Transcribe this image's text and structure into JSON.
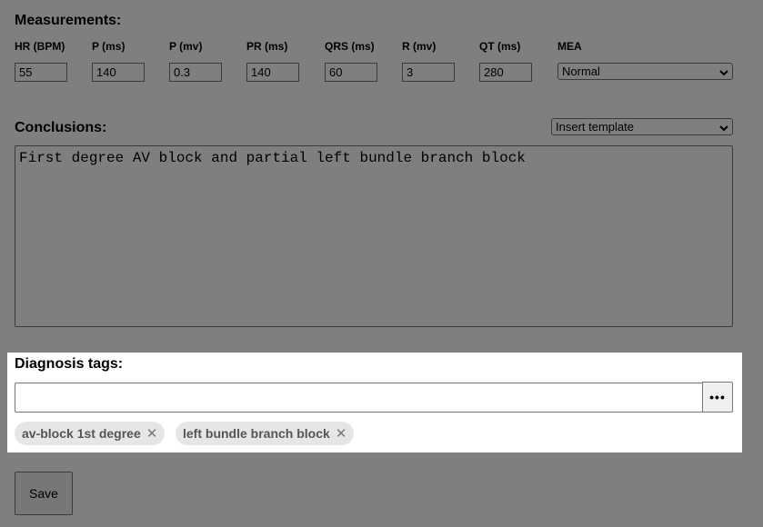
{
  "measurements": {
    "title": "Measurements:",
    "fields": [
      {
        "label": "HR (BPM)",
        "value": "55"
      },
      {
        "label": "P (ms)",
        "value": "140"
      },
      {
        "label": "P (mv)",
        "value": "0.3"
      },
      {
        "label": "PR (ms)",
        "value": "140"
      },
      {
        "label": "QRS (ms)",
        "value": "60"
      },
      {
        "label": "R (mv)",
        "value": "3"
      },
      {
        "label": "QT (ms)",
        "value": "280"
      }
    ],
    "mea": {
      "label": "MEA",
      "value": "Normal"
    }
  },
  "conclusions": {
    "title": "Conclusions:",
    "template_select": "Insert template",
    "text": "First degree AV block and partial left bundle branch block"
  },
  "diagnosis_tags": {
    "title": "Diagnosis tags:",
    "input_value": "",
    "more_button": "•••",
    "tags": [
      {
        "label": "av-block 1st degree",
        "remove": "✕"
      },
      {
        "label": "left bundle branch block",
        "remove": "✕"
      }
    ]
  },
  "actions": {
    "save_label": "Save"
  },
  "icons": {
    "caret": "chevron-down-icon",
    "remove": "close-icon",
    "more": "ellipsis-icon"
  }
}
